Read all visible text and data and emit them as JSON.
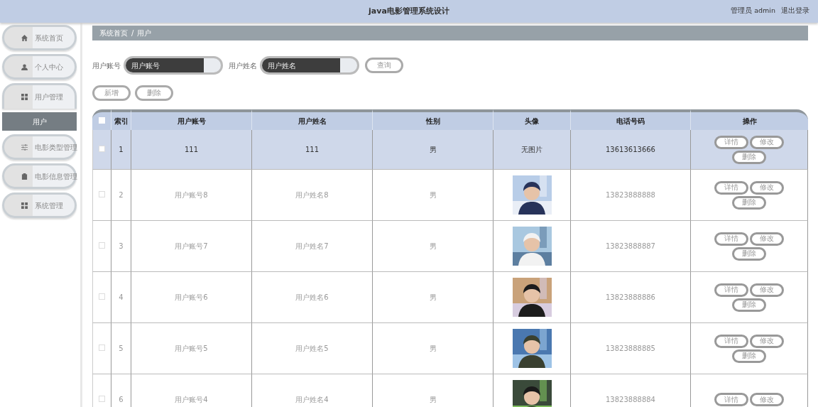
{
  "header": {
    "title": "java电影管理系统设计",
    "user": "管理员 admin",
    "logout": "退出登录"
  },
  "sidebar": {
    "items": [
      {
        "label": "系统首页",
        "expanded": false
      },
      {
        "label": "个人中心",
        "expanded": false
      },
      {
        "label": "用户管理",
        "expanded": true,
        "children": [
          {
            "label": "用户",
            "selected": true
          }
        ]
      },
      {
        "label": "电影类型管理",
        "expanded": false
      },
      {
        "label": "电影信息管理",
        "expanded": false
      },
      {
        "label": "系统管理",
        "expanded": false
      }
    ]
  },
  "breadcrumb": [
    "系统首页",
    "用户"
  ],
  "breadcrumb_separator": "/",
  "search": {
    "fields": [
      {
        "label": "用户账号",
        "placeholder": "用户账号"
      },
      {
        "label": "用户姓名",
        "placeholder": "用户姓名"
      }
    ],
    "button": "查询"
  },
  "actions": [
    "新增",
    "删除"
  ],
  "table": {
    "columns": [
      "索引",
      "用户账号",
      "用户姓名",
      "性别",
      "头像",
      "电话号码",
      "操作"
    ],
    "select_all_checked": false,
    "rows": [
      {
        "selected": true,
        "checked": false,
        "index": "1",
        "account": "111",
        "name": "111",
        "gender": "男",
        "avatar": {
          "kind": "text",
          "text": "无图片"
        },
        "phone": "13613613666",
        "buttons": [
          "详情",
          "修改",
          "删除"
        ]
      },
      {
        "selected": false,
        "checked": false,
        "index": "2",
        "account": "用户账号8",
        "name": "用户姓名8",
        "gender": "男",
        "avatar": {
          "kind": "picture"
        },
        "phone": "13823888888",
        "buttons": [
          "详情",
          "修改",
          "删除"
        ]
      },
      {
        "selected": false,
        "checked": false,
        "index": "3",
        "account": "用户账号7",
        "name": "用户姓名7",
        "gender": "男",
        "avatar": {
          "kind": "picture"
        },
        "phone": "13823888887",
        "buttons": [
          "详情",
          "修改",
          "删除"
        ]
      },
      {
        "selected": false,
        "checked": false,
        "index": "4",
        "account": "用户账号6",
        "name": "用户姓名6",
        "gender": "男",
        "avatar": {
          "kind": "picture"
        },
        "phone": "13823888886",
        "buttons": [
          "详情",
          "修改",
          "删除"
        ]
      },
      {
        "selected": false,
        "checked": false,
        "index": "5",
        "account": "用户账号5",
        "name": "用户姓名5",
        "gender": "男",
        "avatar": {
          "kind": "picture"
        },
        "phone": "13823888885",
        "buttons": [
          "详情",
          "修改",
          "删除"
        ]
      },
      {
        "selected": false,
        "checked": false,
        "index": "6",
        "account": "用户账号4",
        "name": "用户姓名4",
        "gender": "男",
        "avatar": {
          "kind": "picture"
        },
        "phone": "13823888884",
        "buttons": [
          "详情",
          "修改"
        ]
      }
    ]
  }
}
